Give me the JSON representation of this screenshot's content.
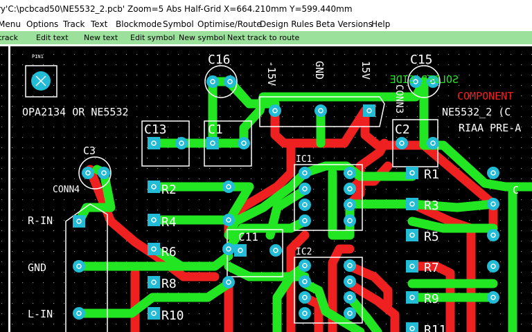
{
  "window": {
    "title": "ry'C:\\pcbcad50\\NE5532_2.pcb' Zoom=5 Abs Half-Grid X=664.210mm Y=599.440mm"
  },
  "menu": {
    "items": [
      {
        "label": "Menu"
      },
      {
        "label": "Options"
      },
      {
        "label": "Track"
      },
      {
        "label": "Text"
      },
      {
        "label": "Blockmode"
      },
      {
        "label": "Symbol"
      },
      {
        "label": "Optimise/Route"
      },
      {
        "label": "Design Rules"
      },
      {
        "label": "Beta Versions"
      },
      {
        "label": "Help"
      }
    ]
  },
  "toolbar": {
    "items": [
      {
        "label": "track"
      },
      {
        "label": "Edit text"
      },
      {
        "label": "New text"
      },
      {
        "label": "Edit symbol"
      },
      {
        "label": "New symbol"
      },
      {
        "label": "Next track to route"
      }
    ]
  },
  "pcb": {
    "colors": {
      "background": "#000000",
      "top_track": "#22e622",
      "bottom_track": "#ee2020",
      "pad": "#22bcd6",
      "silkscreen": "#ffffff",
      "grid": "#8a8a8a"
    },
    "labels": {
      "pin1": "PIN1",
      "board_note": "OPA2134 OR NE5532",
      "c16": "C16",
      "c15": "C15",
      "minus15v": "-15V",
      "gnd_top": "GND",
      "plus15v": "15V",
      "conn_right": "CONN3",
      "solder_side": "SOLDER SIDE",
      "component_side": "COMPONENT",
      "board_name": "NE5532_2 (C",
      "riaa": "RIAA PRE-A",
      "c13": "C13",
      "c1": "C1",
      "c2": "C2",
      "c3": "C3",
      "ic1": "IC1",
      "ic2": "IC2",
      "conn4": "CONN4",
      "r1": "R1",
      "r2": "R2",
      "r3": "R3",
      "r4": "R4",
      "r5": "R5",
      "r6": "R6",
      "r7": "R7",
      "r8": "R8",
      "r9": "R9",
      "r10": "R10",
      "r11": "R11",
      "c11": "C11",
      "conn_far_right": "C",
      "r_in": "R-IN",
      "gnd_left": "GND",
      "l_in": "L-IN"
    }
  }
}
